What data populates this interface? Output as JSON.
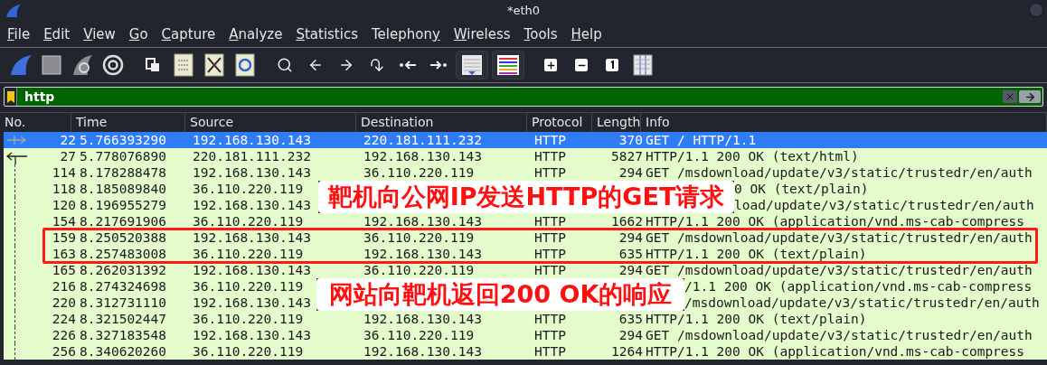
{
  "window": {
    "title": "*eth0"
  },
  "menu": [
    {
      "key": "F",
      "post": "ile"
    },
    {
      "key": "E",
      "post": "dit"
    },
    {
      "key": "V",
      "post": "iew"
    },
    {
      "key": "G",
      "post": "o"
    },
    {
      "key": "C",
      "post": "apture"
    },
    {
      "key": "A",
      "post": "nalyze"
    },
    {
      "key": "S",
      "post": "tatistics"
    },
    {
      "pre": "Telephon",
      "key": "y"
    },
    {
      "key": "W",
      "post": "ireless"
    },
    {
      "key": "T",
      "post": "ools"
    },
    {
      "key": "H",
      "post": "elp"
    }
  ],
  "filter": {
    "value": "http"
  },
  "table": {
    "columns": [
      "No.",
      "Time",
      "Source",
      "Destination",
      "Protocol",
      "Length",
      "Info"
    ],
    "entries": [
      {
        "kind": "request",
        "selected": true,
        "no": "22",
        "time": "5.766393290",
        "source": "192.168.130.143",
        "destination": "220.181.111.232",
        "protocol": "HTTP",
        "length": "370",
        "info": "GET / HTTP/1.1"
      },
      {
        "kind": "response",
        "selected": false,
        "no": "27",
        "time": "5.778076890",
        "source": "220.181.111.232",
        "destination": "192.168.130.143",
        "protocol": "HTTP",
        "length": "5827",
        "info": "HTTP/1.1 200 OK  (text/html)"
      },
      {
        "kind": "row",
        "selected": false,
        "no": "114",
        "time": "8.178288478",
        "source": "192.168.130.143",
        "destination": "36.110.220.119",
        "protocol": "HTTP",
        "length": "294",
        "info": "GET /msdownload/update/v3/static/trustedr/en/auth"
      },
      {
        "kind": "note",
        "text": "靶机向公网IP发送HTTP的GET请求",
        "rows": [
          {
            "selected": false,
            "no": "118",
            "time": "8.185089840",
            "source": "36.110.220.119",
            "info": "0 OK  (text/plain)"
          },
          {
            "selected": false,
            "no": "120",
            "time": "8.196955279",
            "source": "192.168.130.143",
            "info": "load/update/v3/static/trustedr/en/auth"
          }
        ]
      },
      {
        "kind": "row",
        "selected": false,
        "no": "154",
        "time": "8.217691906",
        "source": "36.110.220.119",
        "destination": "192.168.130.143",
        "protocol": "HTTP",
        "length": "1662",
        "info": "HTTP/1.1 200 OK  (application/vnd.ms-cab-compress"
      },
      {
        "kind": "highlight",
        "rows": [
          {
            "selected": false,
            "no": "159",
            "time": "8.250520388",
            "source": "192.168.130.143",
            "destination": "36.110.220.119",
            "protocol": "HTTP",
            "length": "294",
            "info": "GET /msdownload/update/v3/static/trustedr/en/auth"
          },
          {
            "selected": false,
            "no": "163",
            "time": "8.257483008",
            "source": "36.110.220.119",
            "destination": "192.168.130.143",
            "protocol": "HTTP",
            "length": "635",
            "info": "HTTP/1.1 200 OK  (text/plain)"
          }
        ]
      },
      {
        "kind": "row",
        "selected": false,
        "no": "165",
        "time": "8.262031392",
        "source": "192.168.130.143",
        "destination": "36.110.220.119",
        "protocol": "HTTP",
        "length": "294",
        "info": "GET /msdownload/update/v3/static/trustedr/en/auth"
      },
      {
        "kind": "note",
        "text": "网站向靶机返回200 OK的响应",
        "rows": [
          {
            "selected": false,
            "no": "216",
            "time": "8.274324698",
            "source": "36.110.220.119",
            "info": "/1.1 200 OK  (application/vnd.ms-cab-compress"
          },
          {
            "selected": false,
            "no": "220",
            "time": "8.312731110",
            "source": "192.168.130.143",
            "info": "/msdownload/update/v3/static/trustedr/en/auth"
          }
        ]
      },
      {
        "kind": "row",
        "selected": false,
        "no": "224",
        "time": "8.321502447",
        "source": "36.110.220.119",
        "destination": "192.168.130.143",
        "protocol": "HTTP",
        "length": "635",
        "info": "HTTP/1.1 200 OK  (text/plain)"
      },
      {
        "kind": "row",
        "selected": false,
        "no": "226",
        "time": "8.327183548",
        "source": "192.168.130.143",
        "destination": "36.110.220.119",
        "protocol": "HTTP",
        "length": "294",
        "info": "GET /msdownload/update/v3/static/trustedr/en/auth"
      },
      {
        "kind": "row",
        "selected": false,
        "no": "256",
        "time": "8.340620260",
        "source": "36.110.220.119",
        "destination": "192.168.130.143",
        "protocol": "HTTP",
        "length": "1264",
        "info": "HTTP/1.1 200 OK  (application/vnd.ms-cab-compress"
      }
    ]
  }
}
